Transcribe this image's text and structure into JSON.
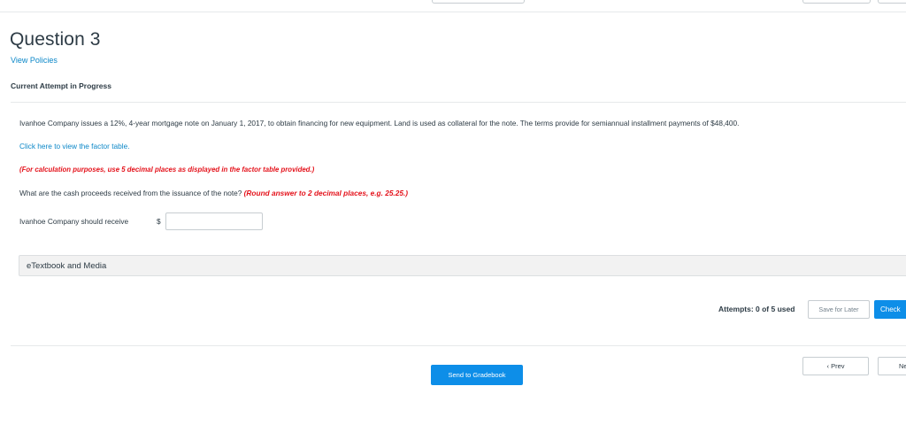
{
  "question": {
    "title": "Question 3",
    "policies_link": "View Policies",
    "attempt_status": "Current Attempt in Progress"
  },
  "problem": {
    "statement": "Ivanhoe Company issues a 12%, 4-year mortgage note on January 1, 2017, to obtain financing for new equipment. Land is used as collateral for the note. The terms provide for semiannual installment payments of $48,400.",
    "factor_table_link": "Click here to view the factor table.",
    "calc_note": "(For calculation purposes, use 5 decimal places as displayed in the factor table provided.)",
    "ask_text": "What are the cash proceeds received from the issuance of the note? ",
    "ask_note": "(Round answer to 2 decimal places, e.g. 25.25.)"
  },
  "answer": {
    "label": "Ivanhoe Company should receive",
    "currency": "$",
    "value": "",
    "placeholder": ""
  },
  "etextbook": {
    "label": "eTextbook and Media"
  },
  "footer": {
    "attempts": "Attempts: 0 of 5 used",
    "save_later": "Save for Later",
    "check_answer": "Check Answer",
    "prev": "Prev",
    "next": "Next",
    "send_gradebook": "Send to Gradebook"
  },
  "icons": {
    "prev": "chevron-left-icon"
  },
  "colors": {
    "accent": "#0d8ee8",
    "link": "#0b87c8",
    "warning_text": "#e4121b",
    "text": "#2d3b45"
  }
}
